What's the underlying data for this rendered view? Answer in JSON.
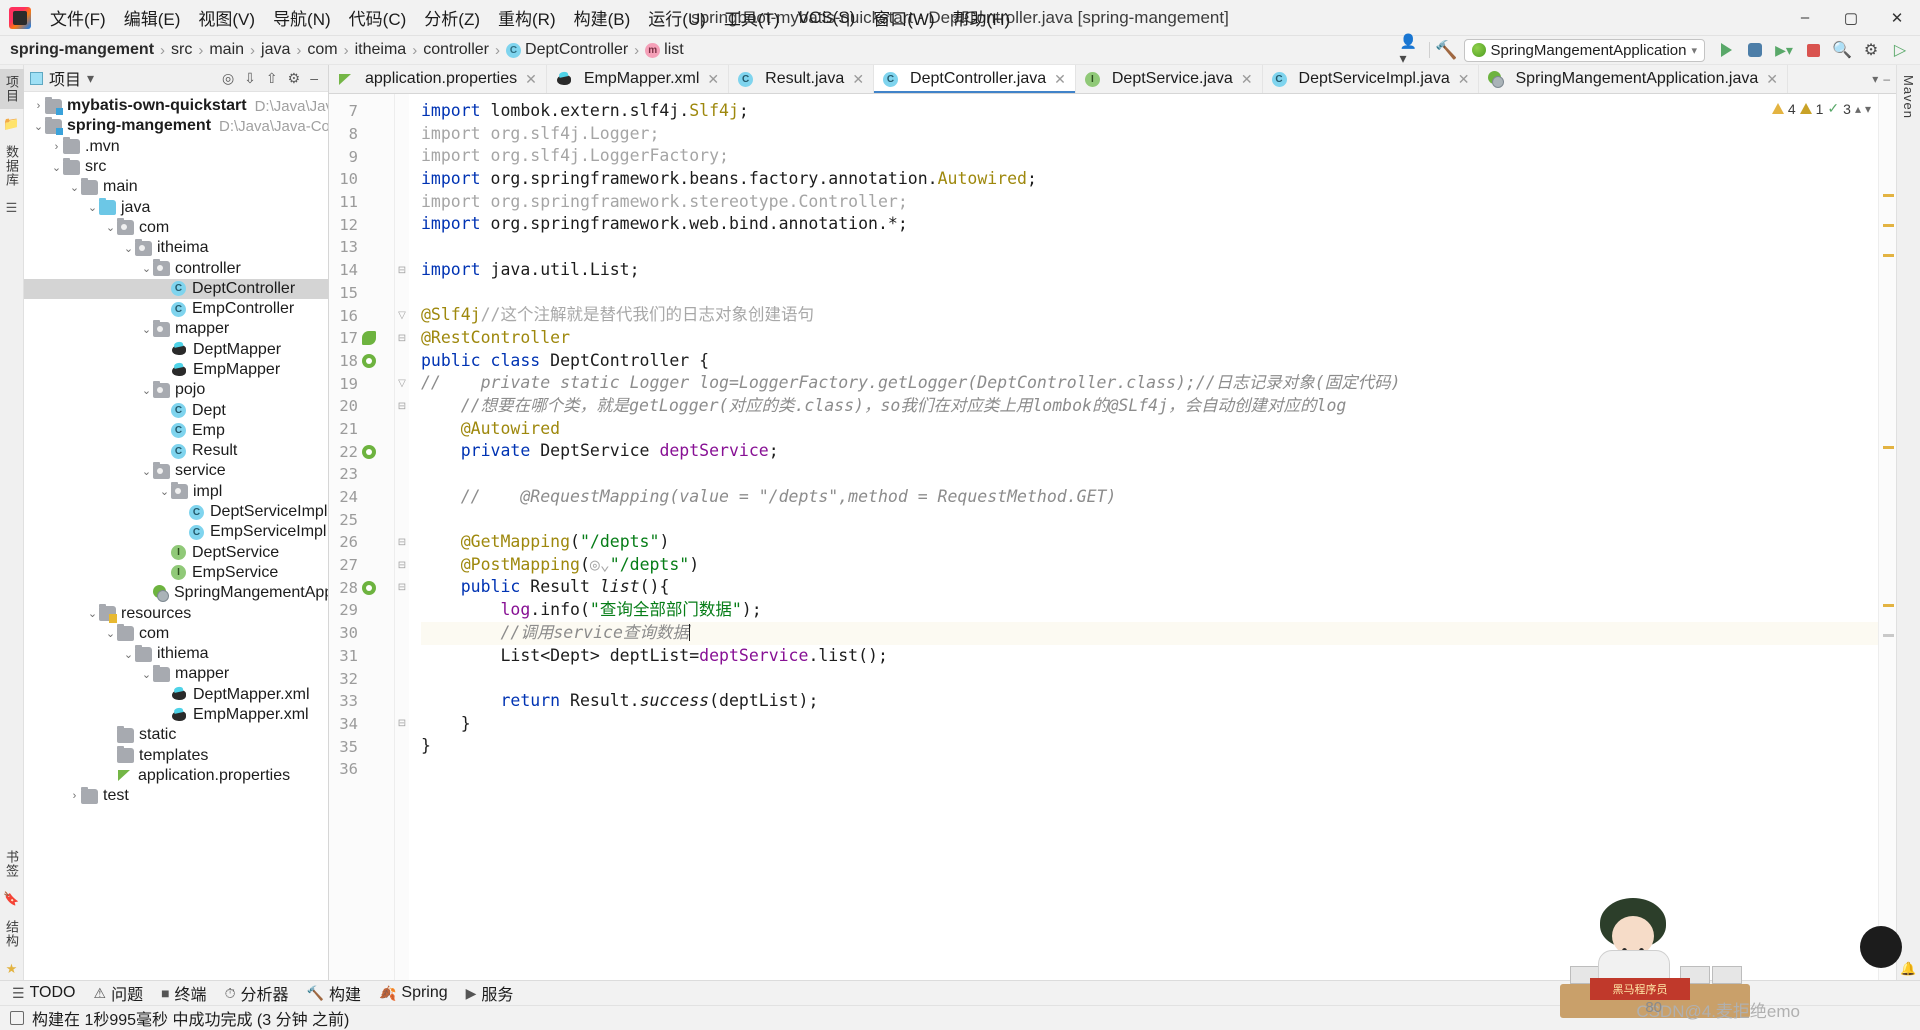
{
  "window": {
    "title": "springboot-mybatis-quickstart - DeptController.java [spring-mangement]",
    "minimize": "–",
    "maximize": "▢",
    "close": "✕"
  },
  "menu": [
    {
      "label": "文件(F)"
    },
    {
      "label": "编辑(E)"
    },
    {
      "label": "视图(V)"
    },
    {
      "label": "导航(N)"
    },
    {
      "label": "代码(C)"
    },
    {
      "label": "分析(Z)"
    },
    {
      "label": "重构(R)"
    },
    {
      "label": "构建(B)"
    },
    {
      "label": "运行(U)"
    },
    {
      "label": "工具(T)"
    },
    {
      "label": "VCS(S)"
    },
    {
      "label": "窗口(W)"
    },
    {
      "label": "帮助(H)"
    }
  ],
  "breadcrumb": [
    {
      "label": "spring-mangement",
      "bold": true,
      "icon": null
    },
    {
      "label": "src",
      "bold": false,
      "icon": null
    },
    {
      "label": "main",
      "bold": false,
      "icon": null
    },
    {
      "label": "java",
      "bold": false,
      "icon": null
    },
    {
      "label": "com",
      "bold": false,
      "icon": null
    },
    {
      "label": "itheima",
      "bold": false,
      "icon": null
    },
    {
      "label": "controller",
      "bold": false,
      "icon": null
    },
    {
      "label": "DeptController",
      "bold": false,
      "icon": "class-icon"
    },
    {
      "label": "list",
      "bold": false,
      "icon": "method-icon"
    }
  ],
  "toolbar": {
    "run_config": "SpringMangementApplication",
    "profile_icon": "user-profile-icon",
    "build_hammer_icon": "build-hammer-icon",
    "run_icon": "run-icon",
    "debug_icon": "debug-icon",
    "coverage_icon": "coverage-icon",
    "stop_icon": "stop-icon",
    "search_icon": "search-icon",
    "settings_icon": "settings-icon",
    "more_icon": "more-run-icon"
  },
  "left_strip": {
    "project_tab": "项目",
    "database_tab": "数据库",
    "structure_icon": "structure-icon",
    "commit_icon": "commit-icon",
    "bookmarks_icon": "bookmarks-icon",
    "favorites_icon": "star-icon"
  },
  "right_strip": {
    "maven_tab": "Maven",
    "notifications_icon": "notifications-icon"
  },
  "project_panel": {
    "title": "项目",
    "dropdown_icon": "chevron-down-icon",
    "locate_icon": "locate-file-icon",
    "expand_icon": "expand-all-icon",
    "collapse_icon": "collapse-all-icon",
    "settings_icon": "gear-icon",
    "hide_icon": "hide-icon",
    "tree": [
      {
        "indent": 0,
        "arrow": "›",
        "icon": "module-folder",
        "label": "mybatis-own-quickstart",
        "bold": true,
        "path": "D:\\Java\\Java-Code",
        "selected": false
      },
      {
        "indent": 0,
        "arrow": "⌄",
        "icon": "module-folder",
        "label": "spring-mangement",
        "bold": true,
        "path": "D:\\Java\\Java-Code\\spri",
        "selected": false
      },
      {
        "indent": 1,
        "arrow": "›",
        "icon": "folder",
        "label": ".mvn",
        "bold": false,
        "path": "",
        "selected": false
      },
      {
        "indent": 1,
        "arrow": "⌄",
        "icon": "folder",
        "label": "src",
        "bold": false,
        "path": "",
        "selected": false
      },
      {
        "indent": 2,
        "arrow": "⌄",
        "icon": "folder",
        "label": "main",
        "bold": false,
        "path": "",
        "selected": false
      },
      {
        "indent": 3,
        "arrow": "⌄",
        "icon": "source-folder",
        "label": "java",
        "bold": false,
        "path": "",
        "selected": false
      },
      {
        "indent": 4,
        "arrow": "⌄",
        "icon": "package",
        "label": "com",
        "bold": false,
        "path": "",
        "selected": false
      },
      {
        "indent": 5,
        "arrow": "⌄",
        "icon": "package",
        "label": "itheima",
        "bold": false,
        "path": "",
        "selected": false
      },
      {
        "indent": 6,
        "arrow": "⌄",
        "icon": "package",
        "label": "controller",
        "bold": false,
        "path": "",
        "selected": false
      },
      {
        "indent": 7,
        "arrow": "",
        "icon": "class",
        "label": "DeptController",
        "bold": false,
        "path": "",
        "selected": true
      },
      {
        "indent": 7,
        "arrow": "",
        "icon": "class",
        "label": "EmpController",
        "bold": false,
        "path": "",
        "selected": false
      },
      {
        "indent": 6,
        "arrow": "⌄",
        "icon": "package",
        "label": "mapper",
        "bold": false,
        "path": "",
        "selected": false
      },
      {
        "indent": 7,
        "arrow": "",
        "icon": "mybatis",
        "label": "DeptMapper",
        "bold": false,
        "path": "",
        "selected": false
      },
      {
        "indent": 7,
        "arrow": "",
        "icon": "mybatis",
        "label": "EmpMapper",
        "bold": false,
        "path": "",
        "selected": false
      },
      {
        "indent": 6,
        "arrow": "⌄",
        "icon": "package",
        "label": "pojo",
        "bold": false,
        "path": "",
        "selected": false
      },
      {
        "indent": 7,
        "arrow": "",
        "icon": "class",
        "label": "Dept",
        "bold": false,
        "path": "",
        "selected": false
      },
      {
        "indent": 7,
        "arrow": "",
        "icon": "class",
        "label": "Emp",
        "bold": false,
        "path": "",
        "selected": false
      },
      {
        "indent": 7,
        "arrow": "",
        "icon": "class",
        "label": "Result",
        "bold": false,
        "path": "",
        "selected": false
      },
      {
        "indent": 6,
        "arrow": "⌄",
        "icon": "package",
        "label": "service",
        "bold": false,
        "path": "",
        "selected": false
      },
      {
        "indent": 7,
        "arrow": "⌄",
        "icon": "package",
        "label": "impl",
        "bold": false,
        "path": "",
        "selected": false
      },
      {
        "indent": 8,
        "arrow": "",
        "icon": "class",
        "label": "DeptServiceImpl",
        "bold": false,
        "path": "",
        "selected": false
      },
      {
        "indent": 8,
        "arrow": "",
        "icon": "class",
        "label": "EmpServiceImpl",
        "bold": false,
        "path": "",
        "selected": false
      },
      {
        "indent": 7,
        "arrow": "",
        "icon": "interface",
        "label": "DeptService",
        "bold": false,
        "path": "",
        "selected": false
      },
      {
        "indent": 7,
        "arrow": "",
        "icon": "interface",
        "label": "EmpService",
        "bold": false,
        "path": "",
        "selected": false
      },
      {
        "indent": 6,
        "arrow": "",
        "icon": "spring-app",
        "label": "SpringMangementApplic",
        "bold": false,
        "path": "",
        "selected": false
      },
      {
        "indent": 3,
        "arrow": "⌄",
        "icon": "resources-folder",
        "label": "resources",
        "bold": false,
        "path": "",
        "selected": false
      },
      {
        "indent": 4,
        "arrow": "⌄",
        "icon": "folder",
        "label": "com",
        "bold": false,
        "path": "",
        "selected": false
      },
      {
        "indent": 5,
        "arrow": "⌄",
        "icon": "folder",
        "label": "ithiema",
        "bold": false,
        "path": "",
        "selected": false
      },
      {
        "indent": 6,
        "arrow": "⌄",
        "icon": "folder",
        "label": "mapper",
        "bold": false,
        "path": "",
        "selected": false
      },
      {
        "indent": 7,
        "arrow": "",
        "icon": "mybatis",
        "label": "DeptMapper.xml",
        "bold": false,
        "path": "",
        "selected": false
      },
      {
        "indent": 7,
        "arrow": "",
        "icon": "mybatis",
        "label": "EmpMapper.xml",
        "bold": false,
        "path": "",
        "selected": false
      },
      {
        "indent": 4,
        "arrow": "",
        "icon": "folder",
        "label": "static",
        "bold": false,
        "path": "",
        "selected": false
      },
      {
        "indent": 4,
        "arrow": "",
        "icon": "folder",
        "label": "templates",
        "bold": false,
        "path": "",
        "selected": false
      },
      {
        "indent": 4,
        "arrow": "",
        "icon": "properties",
        "label": "application.properties",
        "bold": false,
        "path": "",
        "selected": false
      },
      {
        "indent": 2,
        "arrow": "›",
        "icon": "folder",
        "label": "test",
        "bold": false,
        "path": "",
        "selected": false
      }
    ]
  },
  "editor_tabs": [
    {
      "label": "application.properties",
      "icon": "properties-icon",
      "active": false
    },
    {
      "label": "EmpMapper.xml",
      "icon": "mybatis-icon",
      "active": false
    },
    {
      "label": "Result.java",
      "icon": "class-icon",
      "active": false
    },
    {
      "label": "DeptController.java",
      "icon": "class-icon",
      "active": true
    },
    {
      "label": "DeptService.java",
      "icon": "interface-icon",
      "active": false
    },
    {
      "label": "DeptServiceImpl.java",
      "icon": "class-icon",
      "active": false
    },
    {
      "label": "SpringMangementApplication.java",
      "icon": "spring-app-icon",
      "active": false
    }
  ],
  "inspection": {
    "warnings": "4",
    "weak_warnings": "1",
    "typos": "3",
    "warning_icon": "warning-triangle-icon",
    "weak_warning_icon": "weak-warning-icon",
    "typo_icon": "typo-check-icon",
    "up_icon": "chevron-up-icon",
    "down_icon": "chevron-down-icon"
  },
  "code": {
    "first_line_number": 7,
    "lines": [
      {
        "n": 7,
        "gutter": "",
        "fold": "",
        "highlight": false,
        "tokens": [
          {
            "t": "import ",
            "c": "kw"
          },
          {
            "t": "lombok.extern.slf4j.",
            "c": "txt"
          },
          {
            "t": "Slf4j",
            "c": "gold"
          },
          {
            "t": ";",
            "c": "txt"
          }
        ]
      },
      {
        "n": 8,
        "gutter": "",
        "fold": "",
        "highlight": false,
        "tokens": [
          {
            "t": "import org.slf4j.Logger;",
            "c": "unused"
          }
        ]
      },
      {
        "n": 9,
        "gutter": "",
        "fold": "",
        "highlight": false,
        "tokens": [
          {
            "t": "import org.slf4j.LoggerFactory;",
            "c": "unused"
          }
        ]
      },
      {
        "n": 10,
        "gutter": "",
        "fold": "",
        "highlight": false,
        "tokens": [
          {
            "t": "import ",
            "c": "kw"
          },
          {
            "t": "org.springframework.beans.factory.annotation.",
            "c": "txt"
          },
          {
            "t": "Autowired",
            "c": "gold"
          },
          {
            "t": ";",
            "c": "txt"
          }
        ]
      },
      {
        "n": 11,
        "gutter": "",
        "fold": "",
        "highlight": false,
        "tokens": [
          {
            "t": "import org.springframework.stereotype.Controller;",
            "c": "unused"
          }
        ]
      },
      {
        "n": 12,
        "gutter": "",
        "fold": "",
        "highlight": false,
        "tokens": [
          {
            "t": "import ",
            "c": "kw"
          },
          {
            "t": "org.springframework.web.bind.annotation.*;",
            "c": "txt"
          }
        ]
      },
      {
        "n": 13,
        "gutter": "",
        "fold": "",
        "highlight": false,
        "tokens": []
      },
      {
        "n": 14,
        "gutter": "",
        "fold": "⊟",
        "highlight": false,
        "tokens": [
          {
            "t": "import ",
            "c": "kw"
          },
          {
            "t": "java.util.List;",
            "c": "txt"
          }
        ]
      },
      {
        "n": 15,
        "gutter": "",
        "fold": "",
        "highlight": false,
        "tokens": []
      },
      {
        "n": 16,
        "gutter": "",
        "fold": "▽",
        "highlight": false,
        "tokens": [
          {
            "t": "@Slf4j",
            "c": "anno"
          },
          {
            "t": "//这个注解就是替代我们的日志对象创建语句",
            "c": "cmt-unused"
          }
        ]
      },
      {
        "n": 17,
        "gutter": "leaf",
        "fold": "⊟",
        "highlight": false,
        "tokens": [
          {
            "t": "@RestController",
            "c": "anno"
          }
        ]
      },
      {
        "n": 18,
        "gutter": "bean",
        "fold": "",
        "highlight": false,
        "tokens": [
          {
            "t": "public class ",
            "c": "kw"
          },
          {
            "t": "DeptController",
            "c": "txt"
          },
          {
            "t": " {",
            "c": "txt"
          }
        ]
      },
      {
        "n": 19,
        "gutter": "",
        "fold": "▽",
        "highlight": false,
        "tokens": [
          {
            "t": "//    private static Logger log=LoggerFactory.getLogger(DeptController.class);//日志记录对象(固定代码)",
            "c": "cmt"
          }
        ]
      },
      {
        "n": 20,
        "gutter": "",
        "fold": "⊟",
        "highlight": false,
        "tokens": [
          {
            "t": "    //想要在哪个类，就是getLogger(对应的类.class)，so我们在对应类上用lombok的@SLf4j，会自动创建对应的log",
            "c": "cmt"
          }
        ]
      },
      {
        "n": 21,
        "gutter": "",
        "fold": "",
        "highlight": false,
        "tokens": [
          {
            "t": "    @Autowired",
            "c": "anno"
          }
        ]
      },
      {
        "n": 22,
        "gutter": "bean",
        "fold": "",
        "highlight": false,
        "tokens": [
          {
            "t": "    private ",
            "c": "kw"
          },
          {
            "t": "DeptService ",
            "c": "txt"
          },
          {
            "t": "deptService",
            "c": "fld"
          },
          {
            "t": ";",
            "c": "txt"
          }
        ]
      },
      {
        "n": 23,
        "gutter": "",
        "fold": "",
        "highlight": false,
        "tokens": []
      },
      {
        "n": 24,
        "gutter": "",
        "fold": "",
        "highlight": false,
        "tokens": [
          {
            "t": "    //    @RequestMapping(value = \"/depts\",method = RequestMethod.GET)",
            "c": "cmt"
          }
        ]
      },
      {
        "n": 25,
        "gutter": "",
        "fold": "",
        "highlight": false,
        "tokens": []
      },
      {
        "n": 26,
        "gutter": "",
        "fold": "⊟",
        "highlight": false,
        "tokens": [
          {
            "t": "    @GetMapping",
            "c": "anno"
          },
          {
            "t": "(",
            "c": "txt"
          },
          {
            "t": "\"/depts\"",
            "c": "str"
          },
          {
            "t": ")",
            "c": "txt"
          }
        ]
      },
      {
        "n": 27,
        "gutter": "",
        "fold": "⊟",
        "highlight": false,
        "tokens": [
          {
            "t": "    @PostMapping",
            "c": "anno"
          },
          {
            "t": "(",
            "c": "txt"
          },
          {
            "t": "◎⌄",
            "c": "unused"
          },
          {
            "t": "\"/depts\"",
            "c": "str"
          },
          {
            "t": ")",
            "c": "txt"
          }
        ]
      },
      {
        "n": 28,
        "gutter": "bean",
        "fold": "⊟",
        "highlight": false,
        "tokens": [
          {
            "t": "    public ",
            "c": "kw"
          },
          {
            "t": "Result ",
            "c": "txt"
          },
          {
            "t": "list",
            "c": "mth"
          },
          {
            "t": "(){",
            "c": "txt"
          }
        ]
      },
      {
        "n": 29,
        "gutter": "",
        "fold": "",
        "highlight": false,
        "tokens": [
          {
            "t": "        log",
            "c": "fld"
          },
          {
            "t": ".info(",
            "c": "txt"
          },
          {
            "t": "\"查询全部部门数据\"",
            "c": "str"
          },
          {
            "t": ");",
            "c": "txt"
          }
        ]
      },
      {
        "n": 30,
        "gutter": "",
        "fold": "",
        "highlight": true,
        "tokens": [
          {
            "t": "        //调用service查询数据",
            "c": "cmt"
          }
        ],
        "caret": true
      },
      {
        "n": 31,
        "gutter": "",
        "fold": "",
        "highlight": false,
        "tokens": [
          {
            "t": "        List<Dept> deptList=",
            "c": "txt"
          },
          {
            "t": "deptService",
            "c": "fld"
          },
          {
            "t": ".list();",
            "c": "txt"
          }
        ]
      },
      {
        "n": 32,
        "gutter": "",
        "fold": "",
        "highlight": false,
        "tokens": []
      },
      {
        "n": 33,
        "gutter": "",
        "fold": "",
        "highlight": false,
        "tokens": [
          {
            "t": "        return ",
            "c": "kw"
          },
          {
            "t": "Result.",
            "c": "txt"
          },
          {
            "t": "success",
            "c": "mth"
          },
          {
            "t": "(deptList);",
            "c": "txt"
          }
        ]
      },
      {
        "n": 34,
        "gutter": "",
        "fold": "⊟",
        "highlight": false,
        "tokens": [
          {
            "t": "    }",
            "c": "txt"
          }
        ]
      },
      {
        "n": 35,
        "gutter": "",
        "fold": "",
        "highlight": false,
        "tokens": [
          {
            "t": "}",
            "c": "txt"
          }
        ]
      },
      {
        "n": 36,
        "gutter": "",
        "fold": "",
        "highlight": false,
        "tokens": []
      }
    ]
  },
  "bottom_tools": [
    {
      "label": "TODO",
      "icon": "todo-icon"
    },
    {
      "label": "问题",
      "icon": "problems-icon"
    },
    {
      "label": "终端",
      "icon": "terminal-icon"
    },
    {
      "label": "分析器",
      "icon": "profiler-icon"
    },
    {
      "label": "构建",
      "icon": "build-icon"
    },
    {
      "label": "Spring",
      "icon": "spring-icon"
    },
    {
      "label": "服务",
      "icon": "services-icon"
    }
  ],
  "statusbar": {
    "message": "构建在 1秒995毫秒 中成功完成 (3 分钟 之前)",
    "icon": "build-status-icon"
  },
  "watermark": {
    "text": "CSDN@4.麦拒绝emo",
    "overlay_number": "80",
    "overlay_tag": "黑马程序员"
  },
  "colors": {
    "accent": "#4083c9",
    "spring_green": "#6db33f",
    "keyword_blue": "#0033b3",
    "string_green": "#067d17",
    "annotation_gold": "#9e880d",
    "comment_gray": "#8c8c8c",
    "selection_gray": "#d4d4d4"
  }
}
